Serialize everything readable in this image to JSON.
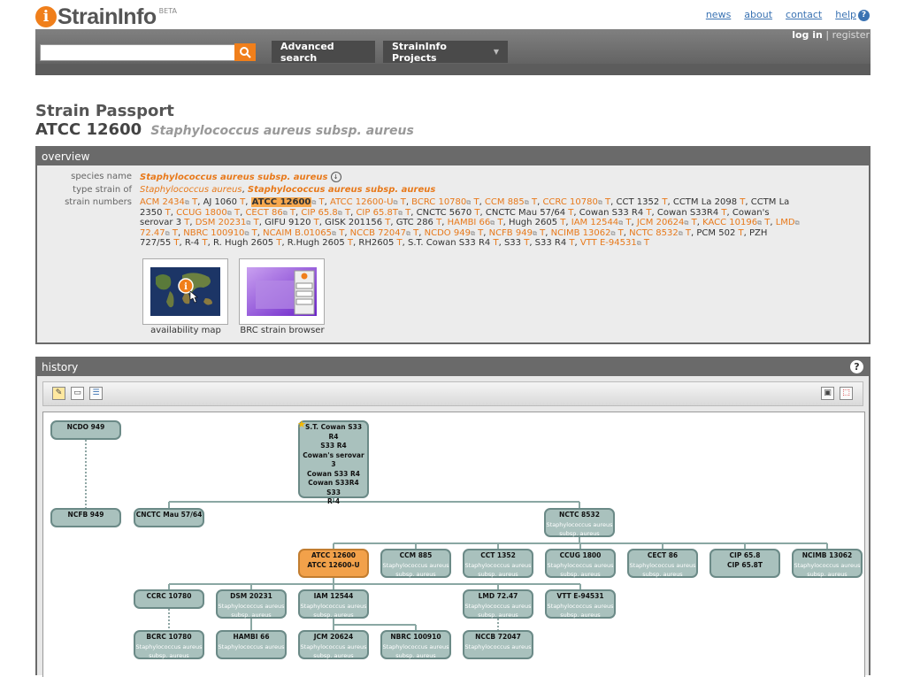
{
  "header": {
    "logo_text": "StrainInfo",
    "logo_badge": "BETA",
    "nav": [
      "news",
      "about",
      "contact",
      "help"
    ],
    "login": "log in",
    "login_sep": " | ",
    "register": "register",
    "search_placeholder": "",
    "advanced_search": "Advanced search",
    "projects": "StrainInfo Projects"
  },
  "page": {
    "title": "Strain Passport",
    "strain": "ATCC 12600",
    "species": "Staphylococcus aureus subsp. aureus"
  },
  "overview": {
    "heading": "overview",
    "species_label": "species name",
    "species_value": "Staphylococcus aureus subsp. aureus",
    "type_label": "type strain of",
    "type_values": [
      "Staphylococcus aureus",
      "Staphylococcus aureus subsp. aureus"
    ],
    "numbers_label": "strain numbers",
    "numbers_html_lines": [
      "ACM 2434, AJ 1060, ATCC 12600, ATCC 12600-U, BCRC 10780, CCM 885, CCRC 10780, CCT 1352, CCTM La 2098, CCTM La",
      "2350, CCUG 1800, CECT 86, CIP 65.8, CIP 65.8T, CNCTC 5670, CNCTC Mau 57/64, Cowan S33 R4, Cowan S33R4, Cowan's",
      "serovar 3, DSM 20231, GIFU 9120, GISK 201156, GTC 286, HAMBI 66, Hugh 2605, IAM 12544, JCM 20624, KACC 10196, LMD",
      "72.47, NBRC 100910, NCAIM B.01065, NCCB 72047, NCDO 949, NCFB 949, NCIMB 13062, NCTC 8532, PCM 502, PZH",
      "727/55, R-4, R. Hugh 2605, R.Hugh 2605, RH2605, S.T. Cowan S33 R4, S33, S33 R4, VTT E-94531"
    ],
    "thumb1_caption": "availability map",
    "thumb2_caption": "BRC strain browser"
  },
  "history": {
    "heading": "history",
    "help": "?",
    "nodes": [
      {
        "id": "n1",
        "title": [
          "NCDO 949"
        ],
        "sub": ""
      },
      {
        "id": "n2",
        "title": [
          "S.T. Cowan S33 R4",
          "S33 R4",
          "Cowan's serovar 3",
          "Cowan S33 R4",
          "Cowan S33R4",
          "S33",
          "R-4"
        ],
        "sub": ""
      },
      {
        "id": "n3",
        "title": [
          "NCFB 949"
        ],
        "sub": ""
      },
      {
        "id": "n4",
        "title": [
          "CNCTC Mau 57/64"
        ],
        "sub": ""
      },
      {
        "id": "n5",
        "title": [
          "NCTC 8532"
        ],
        "sub": "Staphylococcus aureus subsp. aureus"
      },
      {
        "id": "n6",
        "title": [
          "ATCC 12600",
          "ATCC 12600-U"
        ],
        "sub": ""
      },
      {
        "id": "n7",
        "title": [
          "CCM 885"
        ],
        "sub": "Staphylococcus aureus subsp. aureus"
      },
      {
        "id": "n8",
        "title": [
          "CCT 1352"
        ],
        "sub": "Staphylococcus aureus subsp. aureus"
      },
      {
        "id": "n9",
        "title": [
          "CCUG 1800"
        ],
        "sub": "Staphylococcus aureus subsp. aureus"
      },
      {
        "id": "n10",
        "title": [
          "CECT 86"
        ],
        "sub": "Staphylococcus aureus subsp. aureus"
      },
      {
        "id": "n11",
        "title": [
          "CIP 65.8",
          "CIP 65.8T"
        ],
        "sub": ""
      },
      {
        "id": "n12",
        "title": [
          "NCIMB 13062"
        ],
        "sub": "Staphylococcus aureus subsp. aureus"
      },
      {
        "id": "n13",
        "title": [
          "CCRC 10780"
        ],
        "sub": ""
      },
      {
        "id": "n14",
        "title": [
          "DSM 20231"
        ],
        "sub": "Staphylococcus aureus subsp. aureus"
      },
      {
        "id": "n15",
        "title": [
          "IAM 12544"
        ],
        "sub": "Staphylococcus aureus subsp. aureus"
      },
      {
        "id": "n16",
        "title": [
          "LMD 72.47"
        ],
        "sub": "Staphylococcus aureus subsp. aureus"
      },
      {
        "id": "n17",
        "title": [
          "VTT E-94531"
        ],
        "sub": "Staphylococcus aureus subsp. aureus"
      },
      {
        "id": "n18",
        "title": [
          "BCRC 10780"
        ],
        "sub": "Staphylococcus aureus subsp. aureus"
      },
      {
        "id": "n19",
        "title": [
          "HAMBI 66"
        ],
        "sub": "Staphylococcus aureus"
      },
      {
        "id": "n20",
        "title": [
          "JCM 20624"
        ],
        "sub": "Staphylococcus aureus subsp. aureus"
      },
      {
        "id": "n21",
        "title": [
          "NBRC 100910"
        ],
        "sub": "Staphylococcus aureus subsp. aureus"
      },
      {
        "id": "n22",
        "title": [
          "NCCB 72047"
        ],
        "sub": "Staphylococcus aureus"
      }
    ]
  },
  "colors": {
    "accent": "#e8791a",
    "node_fill": "#a9c1bd",
    "node_selected": "#f2a14a",
    "link": "#3b73b3"
  }
}
